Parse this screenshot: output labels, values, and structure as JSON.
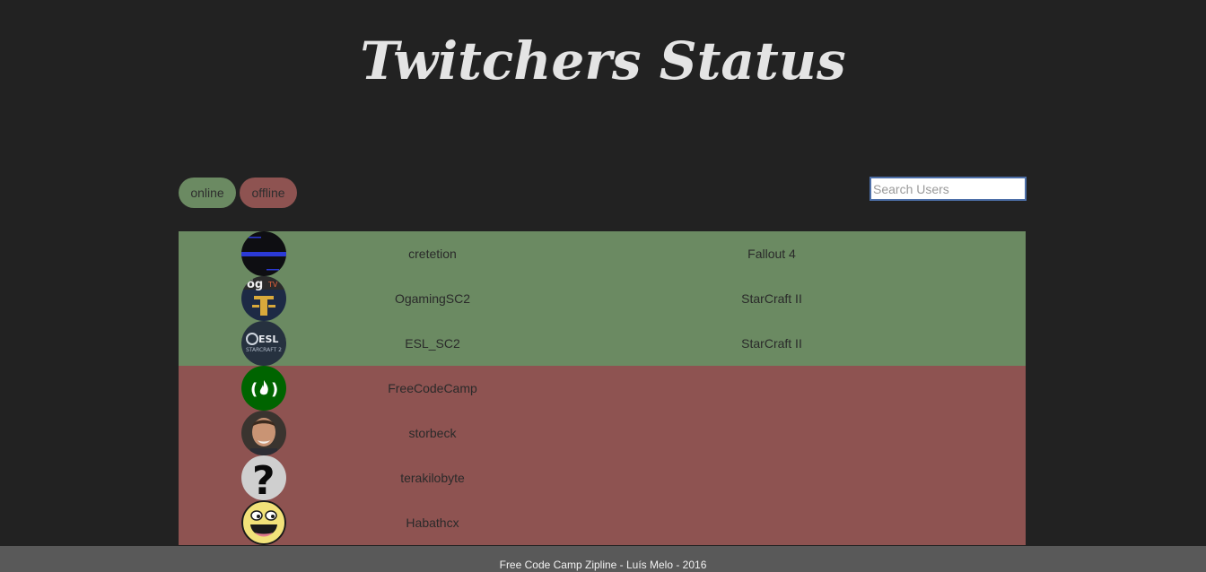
{
  "header": {
    "title": "Twitchers Status"
  },
  "filters": {
    "online_label": "online",
    "offline_label": "offline"
  },
  "search": {
    "placeholder": "Search Users",
    "value": ""
  },
  "colors": {
    "background": "#222222",
    "online": "#6b8a62",
    "offline": "#8e5351",
    "footer": "#595959"
  },
  "users": [
    {
      "name": "cretetion",
      "game": "Fallout 4",
      "status": "online",
      "avatar_icon": "cretetion-avatar-icon"
    },
    {
      "name": "OgamingSC2",
      "game": "StarCraft II",
      "status": "online",
      "avatar_icon": "ogaming-logo-icon"
    },
    {
      "name": "ESL_SC2",
      "game": "StarCraft II",
      "status": "online",
      "avatar_icon": "esl-starcraft-logo-icon"
    },
    {
      "name": "FreeCodeCamp",
      "game": "",
      "status": "offline",
      "avatar_icon": "freecodecamp-logo-icon"
    },
    {
      "name": "storbeck",
      "game": "",
      "status": "offline",
      "avatar_icon": "person-photo-icon"
    },
    {
      "name": "terakilobyte",
      "game": "",
      "status": "offline",
      "avatar_icon": "question-mark-icon"
    },
    {
      "name": "Habathcx",
      "game": "",
      "status": "offline",
      "avatar_icon": "awesome-face-icon"
    }
  ],
  "footer": {
    "text": "Free Code Camp Zipline - Luís Melo - 2016"
  }
}
